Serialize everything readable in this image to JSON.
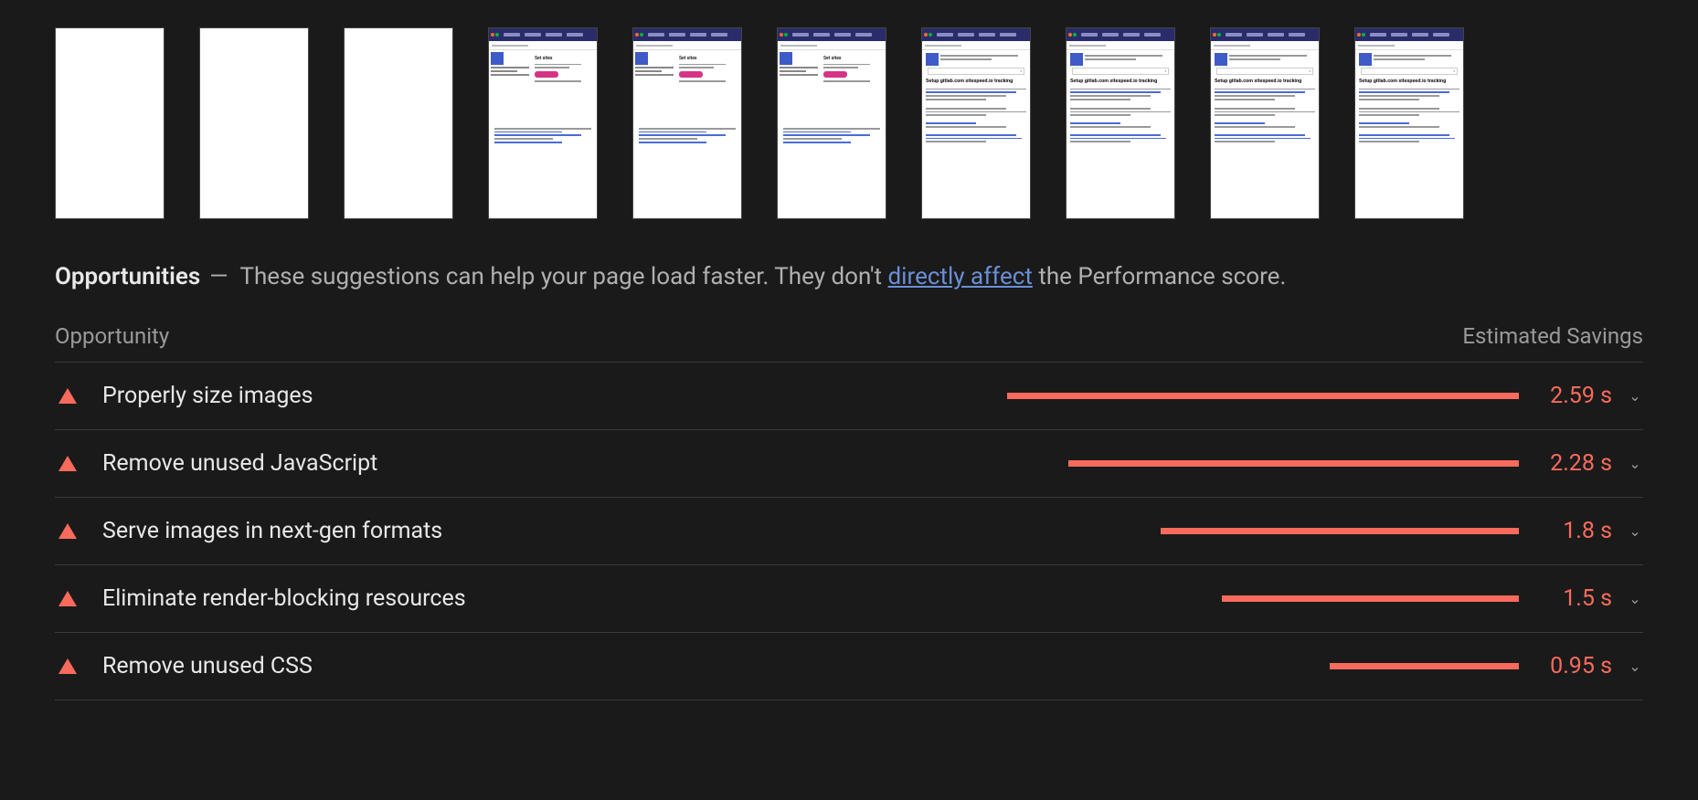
{
  "filmstrip": {
    "frames": [
      {
        "state": "blank"
      },
      {
        "state": "blank"
      },
      {
        "state": "blank"
      },
      {
        "state": "partial"
      },
      {
        "state": "partial"
      },
      {
        "state": "partial"
      },
      {
        "state": "full"
      },
      {
        "state": "full"
      },
      {
        "state": "full"
      },
      {
        "state": "full"
      }
    ],
    "partial_title": "Set sites",
    "full_title": "Setup gitlab.com sitespeed.io tracking"
  },
  "opportunities": {
    "title": "Opportunities",
    "dash": "—",
    "desc_before": "These suggestions can help your page load faster. They don't ",
    "link_text": "directly affect",
    "desc_after": " the Performance score.",
    "col_left": "Opportunity",
    "col_right": "Estimated Savings",
    "items": [
      {
        "label": "Properly size images",
        "savings": "2.59 s",
        "bar_pct": 100
      },
      {
        "label": "Remove unused JavaScript",
        "savings": "2.28 s",
        "bar_pct": 88
      },
      {
        "label": "Serve images in next-gen formats",
        "savings": "1.8 s",
        "bar_pct": 70
      },
      {
        "label": "Eliminate render-blocking resources",
        "savings": "1.5 s",
        "bar_pct": 58
      },
      {
        "label": "Remove unused CSS",
        "savings": "0.95 s",
        "bar_pct": 37
      }
    ]
  }
}
